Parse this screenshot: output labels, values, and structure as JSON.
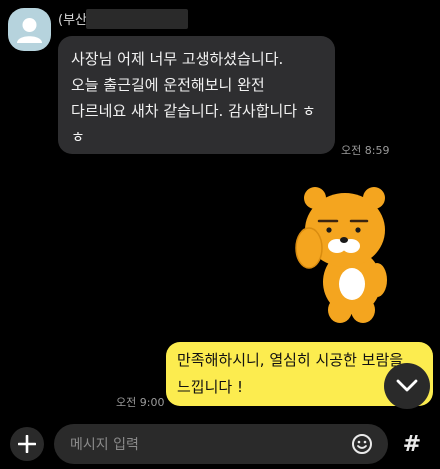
{
  "chat": {
    "sender_name": "(부산)",
    "incoming": {
      "lines": [
        "사장님 어제 너무 고생하셨습니다.",
        "오늘 출근길에 운전해보니 완전",
        "다르네요 새차 같습니다. 감사합니다 ㅎ",
        "ㅎ"
      ],
      "time": "오전 8:59"
    },
    "outgoing": {
      "lines": [
        "만족해하시니, 열심히 시공한 보람을",
        "느낍니다 !"
      ],
      "time": "오전 9:00"
    }
  },
  "input": {
    "placeholder": "메시지 입력",
    "hash_label": "#"
  },
  "icons": {
    "avatar": "person-icon",
    "sticker": "ryan-character-sticker",
    "scroll": "chevron-down-icon",
    "add": "plus-icon",
    "emoji": "smiley-icon"
  },
  "colors": {
    "background": "#000000",
    "incoming_bubble": "#2e2e30",
    "outgoing_bubble": "#fcec4f",
    "sticker_body": "#f4a51f"
  }
}
